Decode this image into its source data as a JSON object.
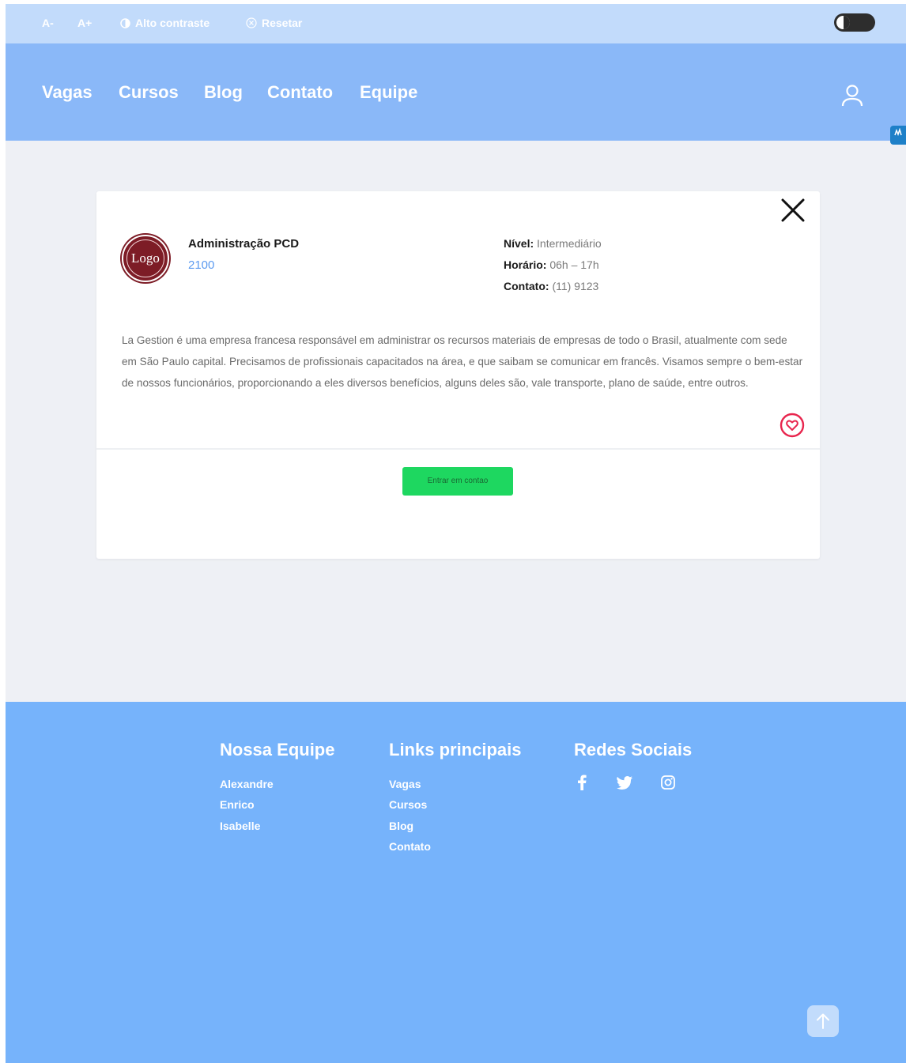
{
  "accessibility_bar": {
    "decrease_font": "A-",
    "increase_font": "A+",
    "high_contrast": "Alto contraste",
    "reset": "Resetar"
  },
  "nav": {
    "links": [
      "Vagas",
      "Cursos",
      "Blog",
      "Contato",
      "Equipe"
    ]
  },
  "job": {
    "logo_text": "Logo",
    "title": "Administração PCD",
    "code": "2100",
    "level_label": "Nível:",
    "level_value": "Intermediário",
    "hours_label": "Horário:",
    "hours_value": "06h – 17h",
    "contact_label": "Contato:",
    "contact_value": "(11) 9123",
    "description": "La Gestion é uma empresa francesa responsável em administrar os recursos materiais de empresas de todo o Brasil, atualmente com sede em São Paulo capital. Precisamos de profissionais capacitados na área, e que saibam se comunicar em francês. Visamos sempre o bem-estar de nossos funcionários, proporcionando a eles diversos benefícios, alguns deles são, vale transporte, plano de saúde, entre outros.",
    "contact_button": "Entrar em contao"
  },
  "footer": {
    "team_heading": "Nossa Equipe",
    "team": [
      "Alexandre",
      "Enrico",
      "Isabelle"
    ],
    "links_heading": "Links principais",
    "links": [
      "Vagas",
      "Cursos",
      "Blog",
      "Contato"
    ],
    "social_heading": "Redes Sociais",
    "social_icons": [
      "facebook-icon",
      "twitter-icon",
      "instagram-icon"
    ]
  },
  "colors": {
    "accessibility_bar": "#c2dbfb",
    "nav": "#8ab8f8",
    "page_background": "#eef0f5",
    "footer": "#76b3fb",
    "contact_button": "#1ed760",
    "heart": "#e8264e",
    "logo": "#7d1c26",
    "job_code": "#5b9af0"
  }
}
